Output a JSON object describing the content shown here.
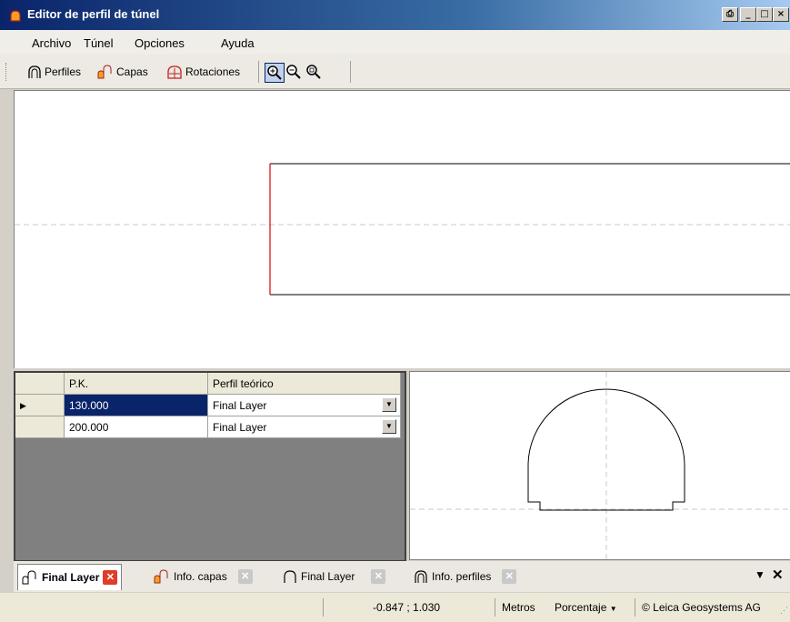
{
  "window": {
    "title": "Editor de perfil de túnel"
  },
  "menu": {
    "items": [
      "Archivo",
      "Túnel",
      "Opciones",
      "Ayuda"
    ]
  },
  "toolbar": {
    "perfiles_label": "Perfiles",
    "capas_label": "Capas",
    "rotaciones_label": "Rotaciones"
  },
  "grid": {
    "headers": [
      "P.K.",
      "Perfil teórico"
    ],
    "rows": [
      {
        "pk": "130.000",
        "perfil": "Final Layer",
        "selected": true
      },
      {
        "pk": "200.000",
        "perfil": "Final Layer",
        "selected": false
      }
    ]
  },
  "tabs": [
    {
      "label": "Final Layer",
      "active": true
    },
    {
      "label": "Info. capas",
      "active": false
    },
    {
      "label": "Final Layer",
      "active": false
    },
    {
      "label": "Info. perfiles",
      "active": false
    }
  ],
  "status": {
    "coords": "-0.847 ; 1.030",
    "units": "Metros",
    "mode": "Porcentaje",
    "copyright": "© Leica Geosystems AG"
  },
  "colors": {
    "titlebar": "#0a246a",
    "selected_row": "#0a246a",
    "tab_close_active": "#e03c28",
    "tab_close_inactive": "#c8c8c8",
    "profile_left_edge": "#e00000"
  }
}
